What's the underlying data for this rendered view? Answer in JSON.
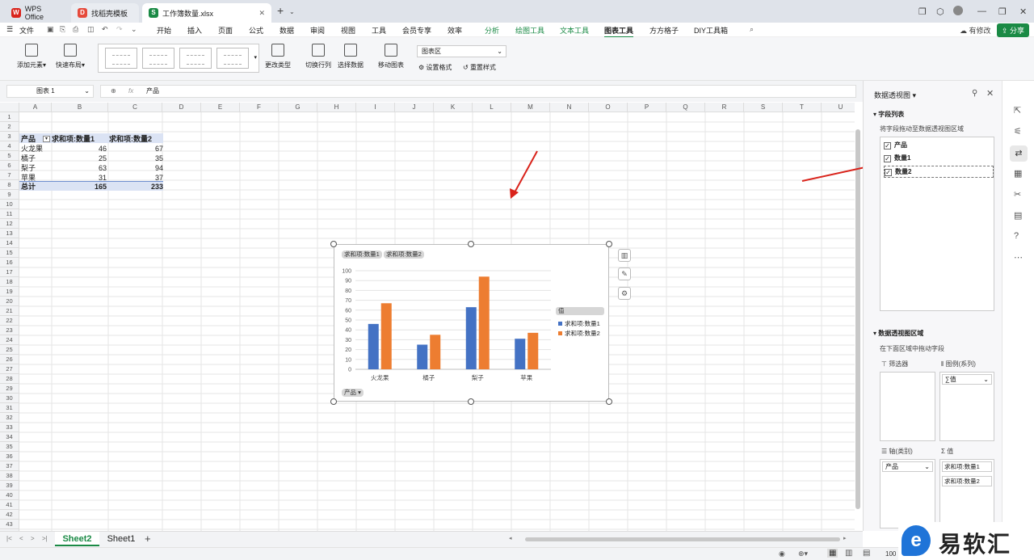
{
  "tabs": [
    {
      "label": "WPS Office"
    },
    {
      "label": "找稻壳模板"
    },
    {
      "label": "工作簿数量.xlsx"
    }
  ],
  "menu": {
    "file": "文件",
    "items": [
      "开始",
      "插入",
      "页面",
      "公式",
      "数据",
      "审阅",
      "视图",
      "工具",
      "会员专享",
      "效率"
    ],
    "context_items": [
      "分析",
      "绘图工具",
      "文本工具"
    ],
    "selected": "图表工具",
    "extra": [
      "方方格子",
      "DIY工具箱"
    ],
    "modify": "有修改",
    "share": "分享"
  },
  "ribbon": {
    "add_element": "添加元素",
    "quick_layout": "快速布局",
    "change_type": "更改类型",
    "switch_rowcol": "切换行列",
    "select_data": "选择数据",
    "move_chart": "移动图表",
    "chart_area": "图表区",
    "set_format": "设置格式",
    "reset_style": "重置样式"
  },
  "formula_bar": {
    "name_box": "图表 1",
    "fx": "fx",
    "content": "产品"
  },
  "columns": [
    "A",
    "B",
    "C",
    "D",
    "E",
    "F",
    "G",
    "H",
    "I",
    "J",
    "K",
    "L",
    "M",
    "N",
    "O",
    "P",
    "Q",
    "R",
    "S",
    "T",
    "U"
  ],
  "row_count": 44,
  "pivot": {
    "headers": [
      "产品",
      "求和项:数量1",
      "求和项:数量2"
    ],
    "rows": [
      [
        "火龙果",
        "46",
        "67"
      ],
      [
        "橘子",
        "25",
        "35"
      ],
      [
        "梨子",
        "63",
        "94"
      ],
      [
        "苹果",
        "31",
        "37"
      ]
    ],
    "total": [
      "总计",
      "165",
      "233"
    ]
  },
  "chart_data": {
    "type": "bar",
    "categories": [
      "火龙果",
      "橘子",
      "梨子",
      "苹果"
    ],
    "series": [
      {
        "name": "求和项:数量1",
        "values": [
          46,
          25,
          63,
          31
        ],
        "color": "#4472c4"
      },
      {
        "name": "求和项:数量2",
        "values": [
          67,
          35,
          94,
          37
        ],
        "color": "#ed7d31"
      }
    ],
    "ylim": [
      0,
      100
    ],
    "yticks": [
      "0",
      "10",
      "20",
      "30",
      "40",
      "50",
      "60",
      "70",
      "80",
      "90",
      "100"
    ],
    "field_pills": [
      "求和项:数量1",
      "求和项:数量2"
    ],
    "axis_pill": "产品",
    "legend_header": "值",
    "legend_position": "right"
  },
  "panel": {
    "title": "数据透视图",
    "field_list": "字段列表",
    "drag_hint": "将字段拖动至数据透视图区域",
    "fields": [
      {
        "label": "产品",
        "checked": true
      },
      {
        "label": "数量1",
        "checked": true
      },
      {
        "label": "数量2",
        "checked": true
      }
    ],
    "area_title": "数据透视图区域",
    "area_hint": "在下面区域中拖动字段",
    "filter": "筛选器",
    "legend": "图例(系列)",
    "legend_value": "∑值",
    "axis": "轴(类别)",
    "axis_value": "产品",
    "values": "值",
    "value_items": [
      "求和项:数量1",
      "求和项:数量2"
    ]
  },
  "sheets": [
    "Sheet2",
    "Sheet1"
  ],
  "active_sheet": "Sheet2",
  "status": {
    "zoom": "100"
  },
  "watermark": "易软汇",
  "colors": {
    "accent": "#1a8a45",
    "arrow": "#d9231b"
  }
}
